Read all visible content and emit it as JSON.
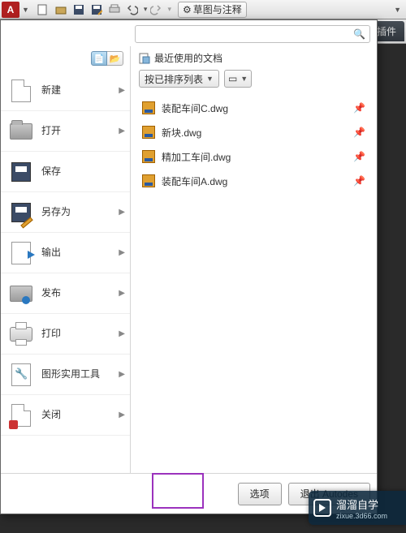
{
  "qat": {
    "workspace_label": "草图与注释"
  },
  "ribbon": {
    "tab_plugin": "插件"
  },
  "search": {
    "placeholder": ""
  },
  "left_menu": {
    "new": "新建",
    "open": "打开",
    "save": "保存",
    "saveas": "另存为",
    "export": "输出",
    "publish": "发布",
    "print": "打印",
    "utilities": "图形实用工具",
    "close": "关闭"
  },
  "recent": {
    "header": "最近使用的文档",
    "sort_label": "按已排序列表",
    "files": [
      "装配车间C.dwg",
      "新块.dwg",
      "精加工车间.dwg",
      "装配车间A.dwg"
    ]
  },
  "footer": {
    "options": "选项",
    "exit": "退出 Autodes"
  },
  "watermark": {
    "title": "溜溜自学",
    "sub": "zixue.3d66.com"
  }
}
